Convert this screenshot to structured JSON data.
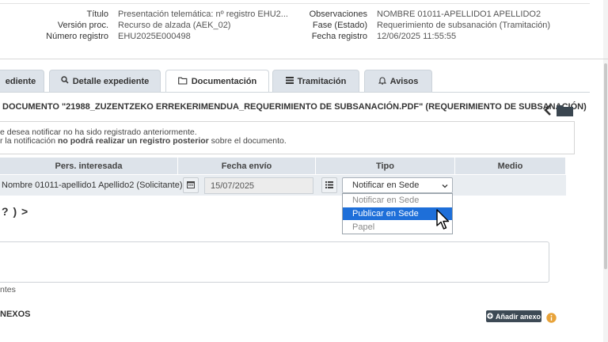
{
  "header": {
    "left": [
      {
        "label": "Título",
        "value": "Presentación telemática: nº registro EHU2..."
      },
      {
        "label": "Versión proc.",
        "value": "Recurso de alzada (AEK_02)"
      },
      {
        "label": "Número registro",
        "value": "EHU2025E000498"
      }
    ],
    "right": [
      {
        "label": "Observaciones",
        "value": "NOMBRE 01011-APELLIDO1 APELLIDO2"
      },
      {
        "label": "Fase (Estado)",
        "value": "Requerimiento de subsanación (Tramitación)"
      },
      {
        "label": "Fecha registro",
        "value": "12/06/2025 11:55:55"
      }
    ]
  },
  "tabs": [
    {
      "label": "ediente",
      "icon": "none"
    },
    {
      "label": "Detalle expediente",
      "icon": "search-icon"
    },
    {
      "label": "Documentación",
      "icon": "folder-icon",
      "active": true
    },
    {
      "label": "Tramitación",
      "icon": "list-icon"
    },
    {
      "label": "Avisos",
      "icon": "bell-icon"
    }
  ],
  "document_title": "DOCUMENTO \"21988_ZUZENTZEKO ERREKERIMENDUA_REQUERIMIENTO DE SUBSANACIÓN.PDF\" (REQUERIMIENTO DE SUBSANACIÓN)",
  "notice": {
    "line1": "e desea notificar no ha sido registrado anteriormente.",
    "line2_prefix": "r la notificación ",
    "line2_bold": "no podrá realizar un registro posterior",
    "line2_suffix": " sobre el documento."
  },
  "table": {
    "headers": [
      "Pers. interesada",
      "Fecha envío",
      "Tipo",
      "Medio"
    ],
    "row": {
      "person": "Nombre 01011-apellido1 Apellido2 (Solicitante)",
      "date": "15/07/2025",
      "tipo_selected": "Notificar en Sede"
    }
  },
  "dropdown_options": [
    {
      "label": "Notificar en Sede",
      "selected": false
    },
    {
      "label": "Publicar en Sede",
      "selected": true
    },
    {
      "label": "Papel",
      "selected": false
    }
  ],
  "nav_symbols": "? ) >",
  "textarea_caption": "ntes",
  "annexes": {
    "title": "NEXOS",
    "add_label": "Añadir anexo"
  },
  "colors": {
    "tab_bg": "#dde3ea",
    "row_bg": "#e9edf1",
    "selected_option": "#1e6fd9",
    "add_button": "#3d4a55",
    "info_icon": "#e8a33a"
  }
}
